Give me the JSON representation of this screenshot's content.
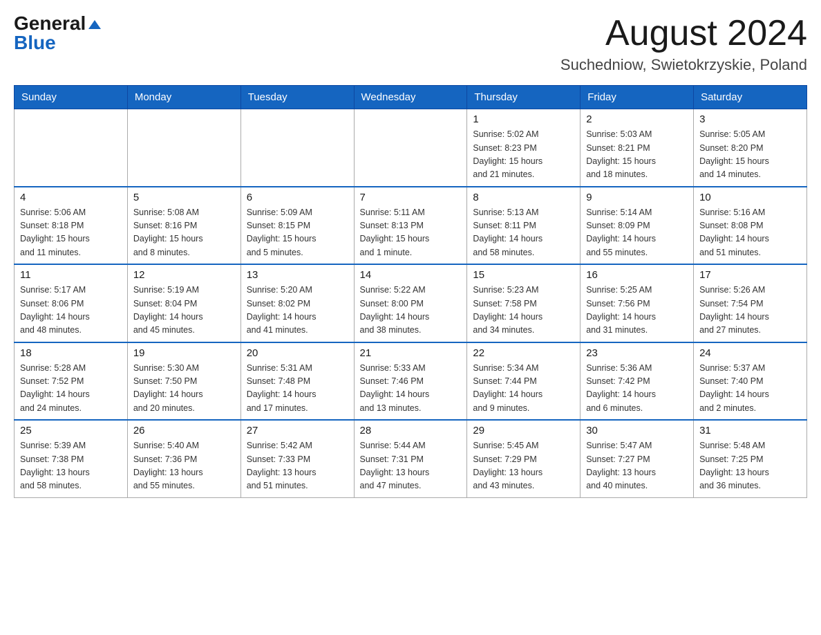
{
  "header": {
    "logo_general": "General",
    "logo_blue": "Blue",
    "month_title": "August 2024",
    "location": "Suchedniow, Swietokrzyskie, Poland"
  },
  "weekdays": [
    "Sunday",
    "Monday",
    "Tuesday",
    "Wednesday",
    "Thursday",
    "Friday",
    "Saturday"
  ],
  "weeks": [
    [
      {
        "day": "",
        "info": ""
      },
      {
        "day": "",
        "info": ""
      },
      {
        "day": "",
        "info": ""
      },
      {
        "day": "",
        "info": ""
      },
      {
        "day": "1",
        "info": "Sunrise: 5:02 AM\nSunset: 8:23 PM\nDaylight: 15 hours\nand 21 minutes."
      },
      {
        "day": "2",
        "info": "Sunrise: 5:03 AM\nSunset: 8:21 PM\nDaylight: 15 hours\nand 18 minutes."
      },
      {
        "day": "3",
        "info": "Sunrise: 5:05 AM\nSunset: 8:20 PM\nDaylight: 15 hours\nand 14 minutes."
      }
    ],
    [
      {
        "day": "4",
        "info": "Sunrise: 5:06 AM\nSunset: 8:18 PM\nDaylight: 15 hours\nand 11 minutes."
      },
      {
        "day": "5",
        "info": "Sunrise: 5:08 AM\nSunset: 8:16 PM\nDaylight: 15 hours\nand 8 minutes."
      },
      {
        "day": "6",
        "info": "Sunrise: 5:09 AM\nSunset: 8:15 PM\nDaylight: 15 hours\nand 5 minutes."
      },
      {
        "day": "7",
        "info": "Sunrise: 5:11 AM\nSunset: 8:13 PM\nDaylight: 15 hours\nand 1 minute."
      },
      {
        "day": "8",
        "info": "Sunrise: 5:13 AM\nSunset: 8:11 PM\nDaylight: 14 hours\nand 58 minutes."
      },
      {
        "day": "9",
        "info": "Sunrise: 5:14 AM\nSunset: 8:09 PM\nDaylight: 14 hours\nand 55 minutes."
      },
      {
        "day": "10",
        "info": "Sunrise: 5:16 AM\nSunset: 8:08 PM\nDaylight: 14 hours\nand 51 minutes."
      }
    ],
    [
      {
        "day": "11",
        "info": "Sunrise: 5:17 AM\nSunset: 8:06 PM\nDaylight: 14 hours\nand 48 minutes."
      },
      {
        "day": "12",
        "info": "Sunrise: 5:19 AM\nSunset: 8:04 PM\nDaylight: 14 hours\nand 45 minutes."
      },
      {
        "day": "13",
        "info": "Sunrise: 5:20 AM\nSunset: 8:02 PM\nDaylight: 14 hours\nand 41 minutes."
      },
      {
        "day": "14",
        "info": "Sunrise: 5:22 AM\nSunset: 8:00 PM\nDaylight: 14 hours\nand 38 minutes."
      },
      {
        "day": "15",
        "info": "Sunrise: 5:23 AM\nSunset: 7:58 PM\nDaylight: 14 hours\nand 34 minutes."
      },
      {
        "day": "16",
        "info": "Sunrise: 5:25 AM\nSunset: 7:56 PM\nDaylight: 14 hours\nand 31 minutes."
      },
      {
        "day": "17",
        "info": "Sunrise: 5:26 AM\nSunset: 7:54 PM\nDaylight: 14 hours\nand 27 minutes."
      }
    ],
    [
      {
        "day": "18",
        "info": "Sunrise: 5:28 AM\nSunset: 7:52 PM\nDaylight: 14 hours\nand 24 minutes."
      },
      {
        "day": "19",
        "info": "Sunrise: 5:30 AM\nSunset: 7:50 PM\nDaylight: 14 hours\nand 20 minutes."
      },
      {
        "day": "20",
        "info": "Sunrise: 5:31 AM\nSunset: 7:48 PM\nDaylight: 14 hours\nand 17 minutes."
      },
      {
        "day": "21",
        "info": "Sunrise: 5:33 AM\nSunset: 7:46 PM\nDaylight: 14 hours\nand 13 minutes."
      },
      {
        "day": "22",
        "info": "Sunrise: 5:34 AM\nSunset: 7:44 PM\nDaylight: 14 hours\nand 9 minutes."
      },
      {
        "day": "23",
        "info": "Sunrise: 5:36 AM\nSunset: 7:42 PM\nDaylight: 14 hours\nand 6 minutes."
      },
      {
        "day": "24",
        "info": "Sunrise: 5:37 AM\nSunset: 7:40 PM\nDaylight: 14 hours\nand 2 minutes."
      }
    ],
    [
      {
        "day": "25",
        "info": "Sunrise: 5:39 AM\nSunset: 7:38 PM\nDaylight: 13 hours\nand 58 minutes."
      },
      {
        "day": "26",
        "info": "Sunrise: 5:40 AM\nSunset: 7:36 PM\nDaylight: 13 hours\nand 55 minutes."
      },
      {
        "day": "27",
        "info": "Sunrise: 5:42 AM\nSunset: 7:33 PM\nDaylight: 13 hours\nand 51 minutes."
      },
      {
        "day": "28",
        "info": "Sunrise: 5:44 AM\nSunset: 7:31 PM\nDaylight: 13 hours\nand 47 minutes."
      },
      {
        "day": "29",
        "info": "Sunrise: 5:45 AM\nSunset: 7:29 PM\nDaylight: 13 hours\nand 43 minutes."
      },
      {
        "day": "30",
        "info": "Sunrise: 5:47 AM\nSunset: 7:27 PM\nDaylight: 13 hours\nand 40 minutes."
      },
      {
        "day": "31",
        "info": "Sunrise: 5:48 AM\nSunset: 7:25 PM\nDaylight: 13 hours\nand 36 minutes."
      }
    ]
  ]
}
